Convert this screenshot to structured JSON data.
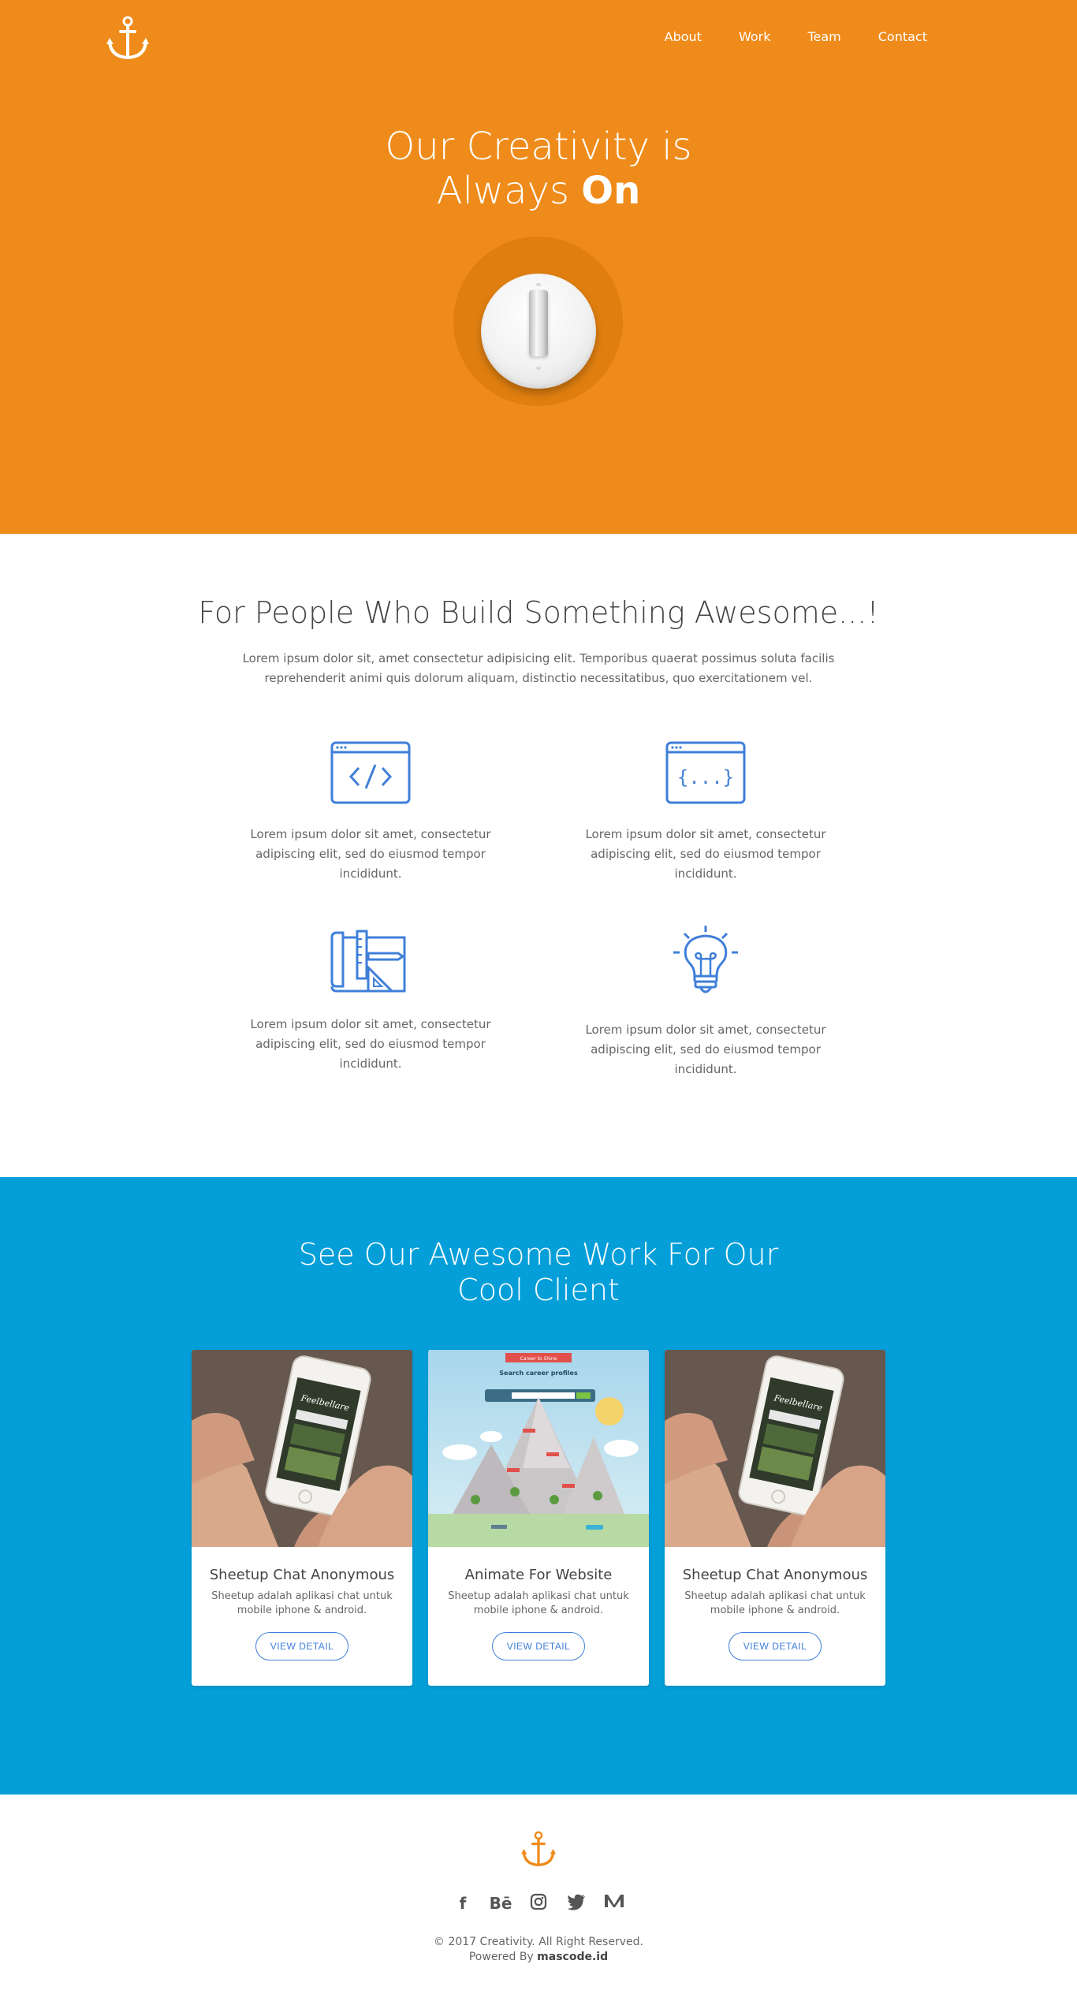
{
  "nav": {
    "items": [
      "About",
      "Work",
      "Team",
      "Contact"
    ]
  },
  "hero": {
    "title_line1": "Our Creativity is",
    "title_line2_prefix": "Always ",
    "title_line2_bold": "On"
  },
  "features": {
    "title": "For People Who Build Something Awesome...!",
    "intro": "Lorem ipsum dolor sit, amet consectetur adipisicing elit. Temporibus quaerat possimus soluta facilis reprehenderit animi quis dolorum aliquam, distinctio necessitatibus, quo exercitationem vel.",
    "items": [
      {
        "icon": "code-window-icon",
        "text": "Lorem ipsum dolor sit amet, consectetur adipiscing elit, sed do eiusmod tempor incididunt."
      },
      {
        "icon": "braces-window-icon",
        "text": "Lorem ipsum dolor sit amet, consectetur adipiscing elit, sed do eiusmod tempor incididunt."
      },
      {
        "icon": "design-tools-icon",
        "text": "Lorem ipsum dolor sit amet, consectetur adipiscing elit, sed do eiusmod tempor incididunt."
      },
      {
        "icon": "lightbulb-icon",
        "text": "Lorem ipsum dolor sit amet, consectetur adipiscing elit, sed do eiusmod tempor incididunt."
      }
    ]
  },
  "work": {
    "title_line1": "See Our Awesome Work For Our",
    "title_line2": "Cool Client",
    "cards": [
      {
        "title": "Sheetup Chat Anonymous",
        "desc": "Sheetup adalah aplikasi chat untuk mobile iphone & android.",
        "button": "VIEW DETAIL"
      },
      {
        "title": "Animate For Website",
        "desc": "Sheetup adalah aplikasi chat untuk mobile iphone & android.",
        "button": "VIEW DETAIL"
      },
      {
        "title": "Sheetup Chat Anonymous",
        "desc": "Sheetup adalah aplikasi chat untuk mobile iphone & android.",
        "button": "VIEW DETAIL"
      }
    ],
    "image_texts": {
      "phone_brand": "Feelbellare",
      "map_banner": "Career to Shine",
      "map_headline": "Search career profiles"
    }
  },
  "footer": {
    "socials": [
      {
        "name": "facebook-icon",
        "glyph": "f"
      },
      {
        "name": "behance-icon",
        "glyph": "Bē"
      },
      {
        "name": "instagram-icon",
        "glyph": ""
      },
      {
        "name": "twitter-icon",
        "glyph": ""
      },
      {
        "name": "medium-icon",
        "glyph": ""
      }
    ],
    "copyright": "© 2017 Creativity. All Right Reserved.",
    "powered_prefix": "Powered By ",
    "powered_by": "mascode.id"
  },
  "colors": {
    "hero_bg": "#ef8b1a",
    "work_bg": "#049fd9",
    "icon_blue": "#3f7fd9",
    "anchor_orange": "#ef8b1a"
  }
}
